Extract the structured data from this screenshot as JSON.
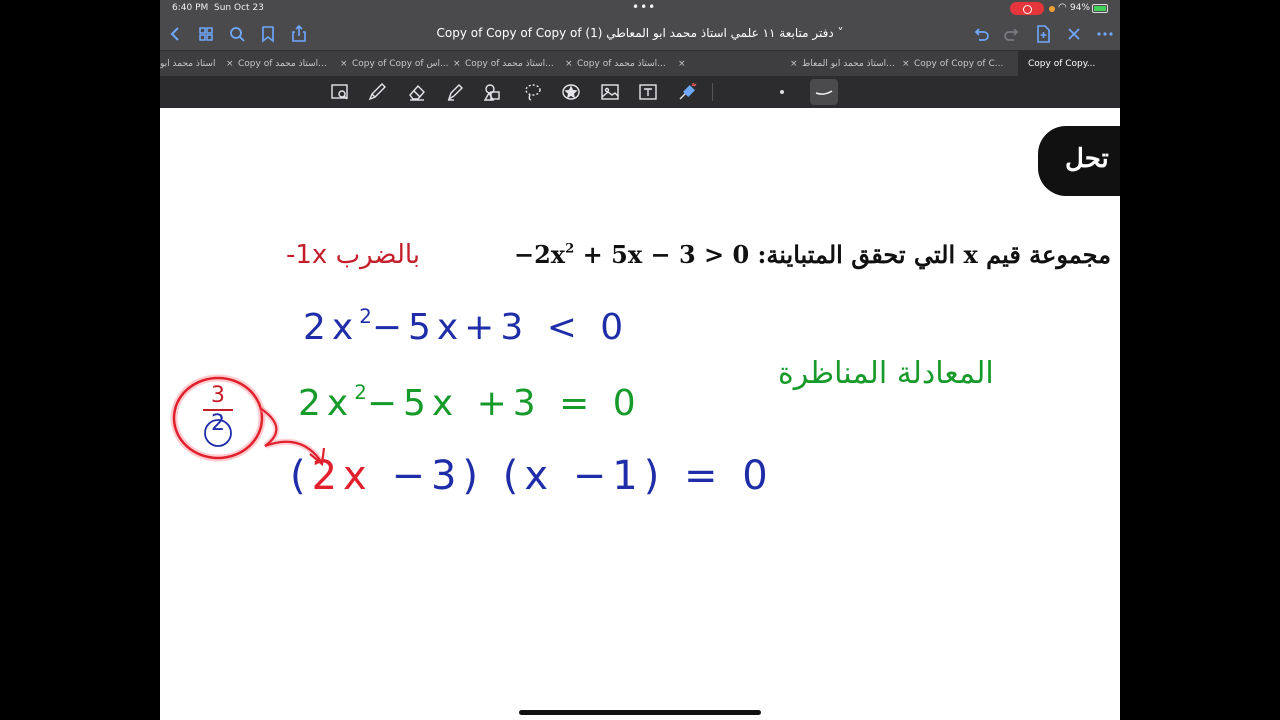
{
  "status": {
    "time": "6:40 PM",
    "date": "Sun Oct 23",
    "battery": "94%"
  },
  "toolbar": {
    "title": "Copy of Copy of Copy of (1) دفتر متابعة ١١ علمي استاذ محمد ابو المعاطي ˅"
  },
  "tabs": [
    {
      "label": "استاذ محمد ابو"
    },
    {
      "label": "Copy of استاذ محمد..."
    },
    {
      "label": "Copy of Copy of اس..."
    },
    {
      "label": "Copy of استاذ محمد..."
    },
    {
      "label": "Copy of استاذ محمد..."
    },
    {
      "label": "استاذ محمد ابو المعاط..."
    },
    {
      "label": "Copy of Copy of C..."
    },
    {
      "label": "Copy of Copy..."
    }
  ],
  "tools": [
    "lasso-select",
    "pen",
    "eraser",
    "highlighter",
    "shapes",
    "lasso",
    "sticker",
    "image",
    "text",
    "laser-pointer"
  ],
  "canvas": {
    "header": "تحل",
    "problem_text": "مجموعة قيم x التي تحقق المتباينة:",
    "problem_eq_left": "−2x",
    "problem_eq_exp": "2",
    "problem_eq_right": " + 5x − 3 > 0",
    "red_note_ar": "بالضرب",
    "red_note_math": "-1x",
    "line1_a": "2x",
    "line1_exp": "2",
    "line1_b": "−5x+3 < 0",
    "line2_a": "2x",
    "line2_exp": "2",
    "line2_b": "−5x +3 = 0",
    "green_note": "المعادلة المناظرة",
    "line3_open": "(",
    "line3_red": "2x",
    "line3_rest": " −3) (x −1) = 0",
    "frac_num": "3",
    "frac_den": "2"
  },
  "colors": {
    "blue_ink": "#1f2ea8",
    "green_ink": "#169a2a",
    "red_ink": "#c41e2a",
    "accent": "#6fa8ff"
  }
}
